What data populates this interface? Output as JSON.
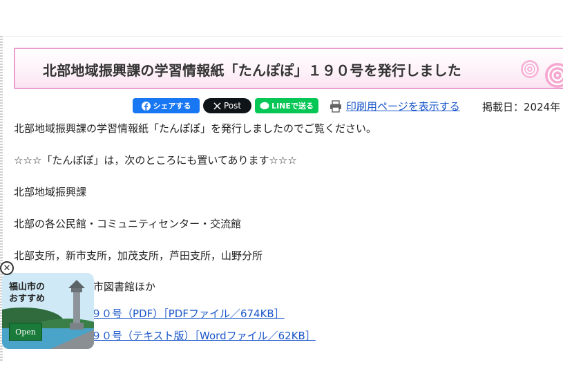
{
  "article": {
    "title": "北部地域振興課の学習情報紙「たんぽぽ」１９０号を発行しました"
  },
  "share": {
    "facebook_label": "シェアする",
    "x_label": "Post",
    "line_label": "LINEで送る"
  },
  "print_link": "印刷用ページを表示する",
  "posted_date": "掲載日：2024年",
  "content": {
    "intro": "北部地域振興課の学習情報紙「たんぽぽ」を発行しましたのでご覧ください。",
    "notice": "☆☆☆「たんぽぽ」は，次のところにも置いてあります☆☆☆",
    "location_1": "北部地域振興課",
    "location_2": "北部の各公民館・コミュニティセンター・交流館",
    "location_3": "北部支所，新市支所，加茂支所，芦田支所，山野分所",
    "location_4": "市図書館ほか",
    "link_pdf": "９０号（PDF）［PDFファイル／674KB］",
    "link_word": "９０号（テキスト版）［Wordファイル／62KB］"
  },
  "ad": {
    "title_line1": "福山市の",
    "title_line2": "おすすめ",
    "open_label": "Open",
    "close_symbol": "✕"
  },
  "colors": {
    "title_border": "#ea9bd0",
    "link": "#1a57c9",
    "facebook": "#1877f2",
    "x": "#0f1419",
    "line": "#06c755"
  }
}
